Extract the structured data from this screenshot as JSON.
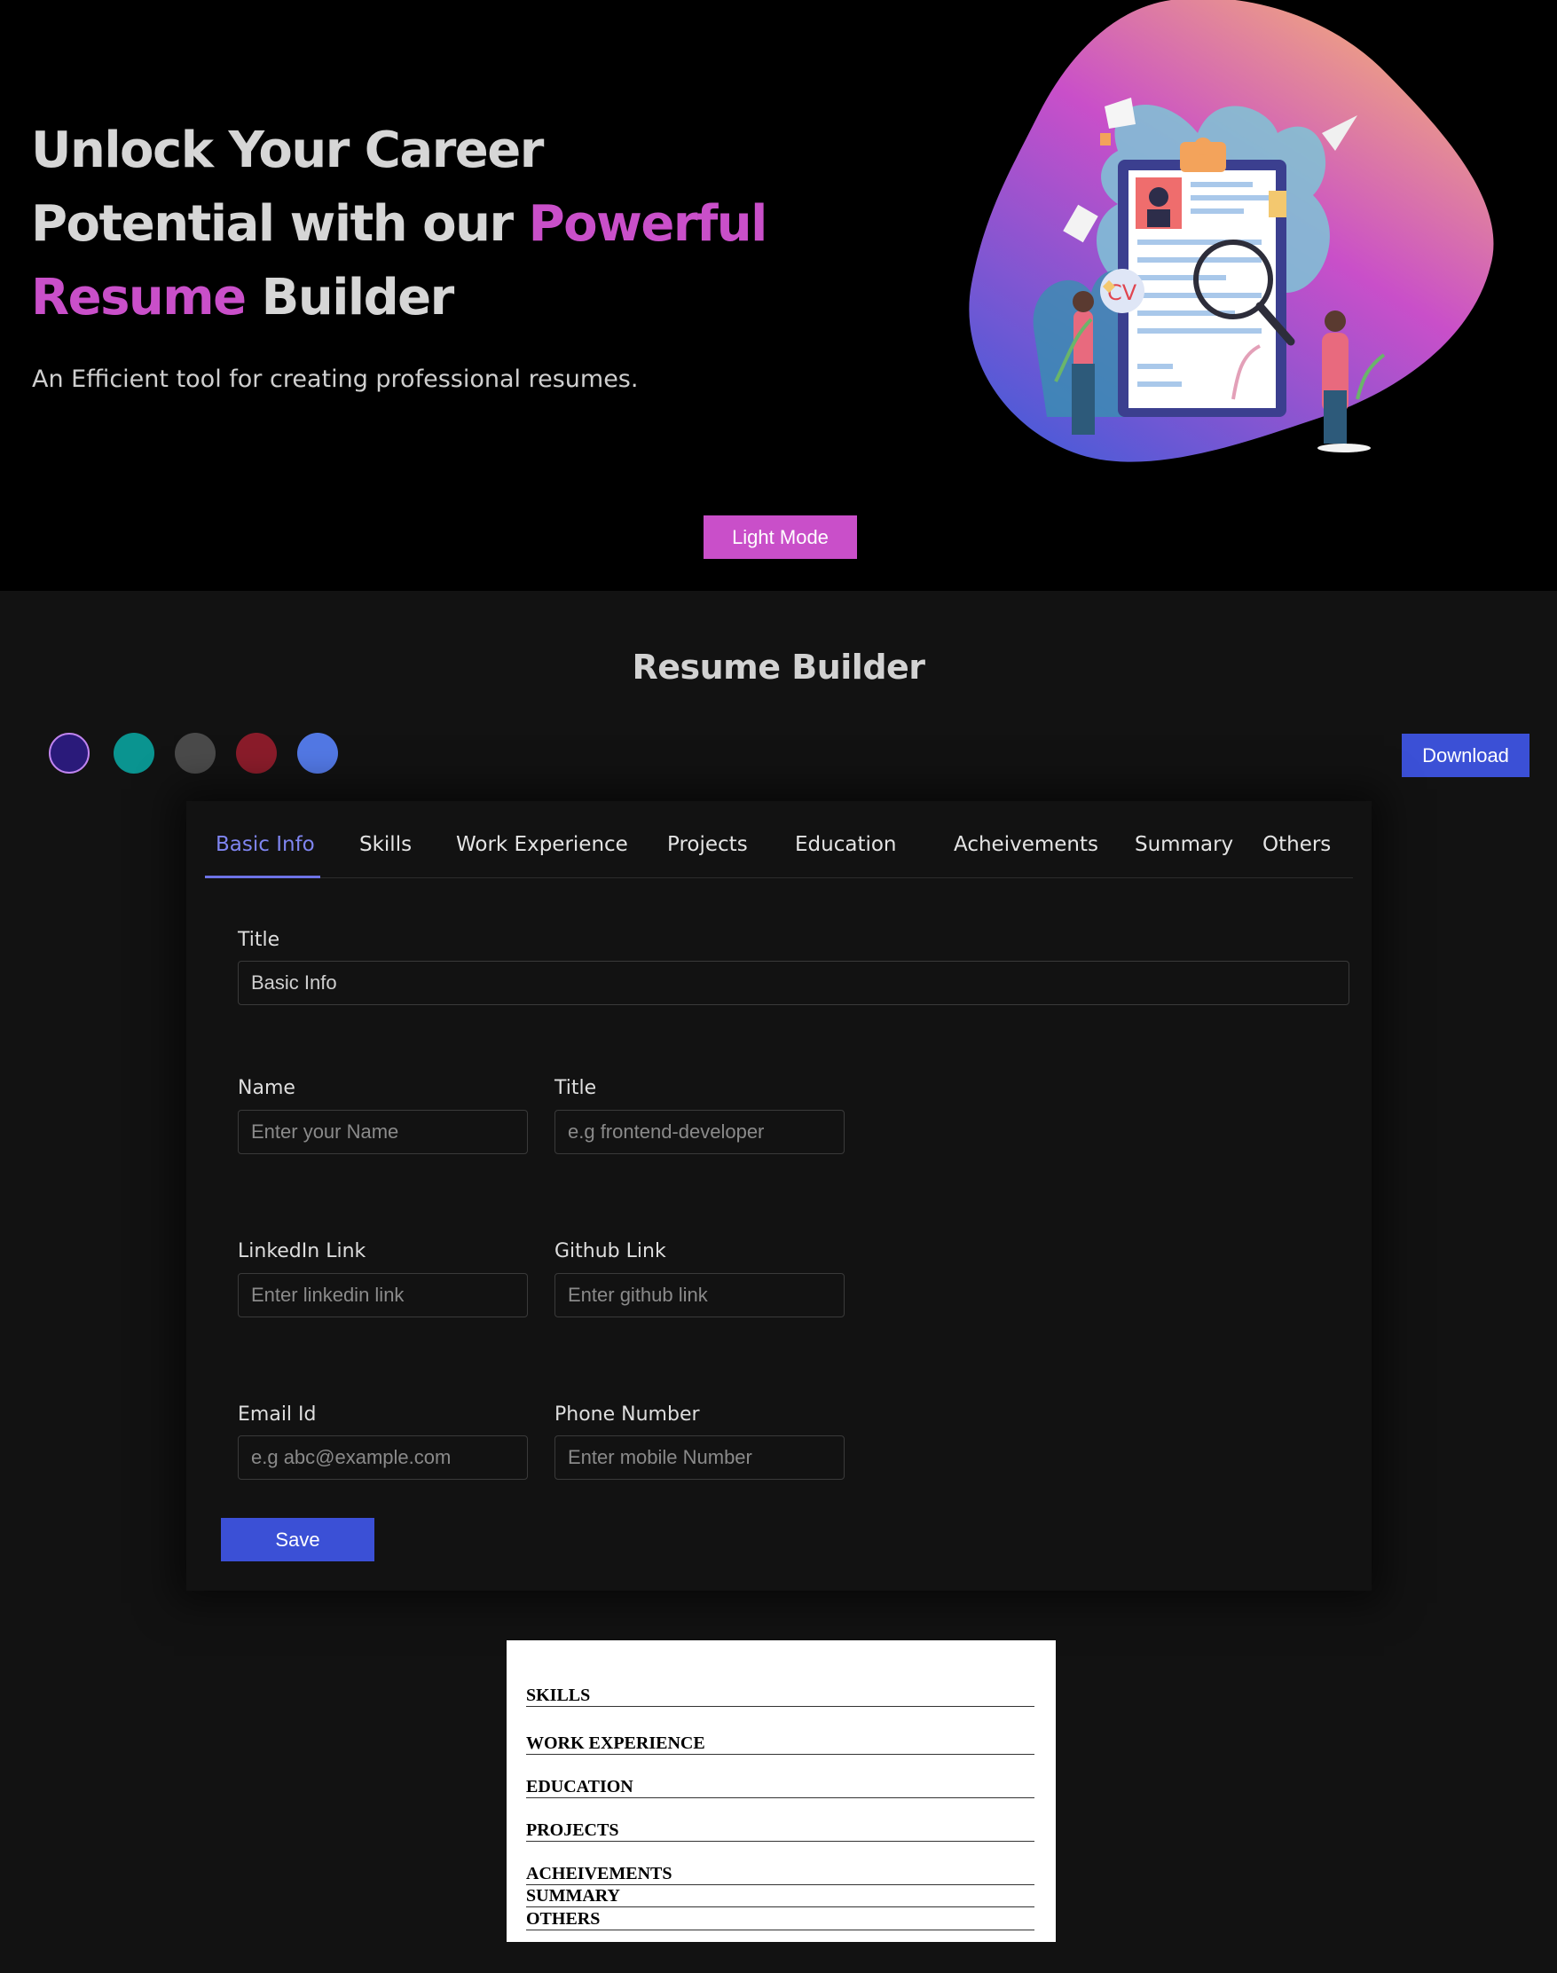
{
  "hero": {
    "heading_part1": "Unlock Your Career Potential with our ",
    "heading_accent": "Powerful Resume",
    "heading_part2": " Builder",
    "subtitle": "An Efficient tool for creating professional resumes.",
    "illustration_label": "CV",
    "light_mode_label": "Light Mode"
  },
  "builder": {
    "title": "Resume Builder",
    "download_label": "Download",
    "colors": [
      "#239ce2",
      "#48bb78",
      "#0bc5ea",
      "#a0aec0",
      "#ed8936"
    ],
    "swatches": [
      "#2a1a7a",
      "#0a9490",
      "#4a4a4a",
      "#8a1c2a",
      "#5278e4"
    ]
  },
  "tabs": [
    "Basic Info",
    "Skills",
    "Work Experience",
    "Projects",
    "Education",
    "Acheivements",
    "Summary",
    "Others"
  ],
  "form": {
    "section_title_label": "Title",
    "section_title_value": "Basic Info",
    "name_label": "Name",
    "name_placeholder": "Enter your Name",
    "title_label": "Title",
    "title_placeholder": "e.g frontend-developer",
    "linkedin_label": "LinkedIn Link",
    "linkedin_placeholder": "Enter linkedin link",
    "github_label": "Github Link",
    "github_placeholder": "Enter github link",
    "email_label": "Email Id",
    "email_placeholder": "e.g abc@example.com",
    "phone_label": "Phone Number",
    "phone_placeholder": "Enter mobile Number",
    "save_label": "Save"
  },
  "preview": {
    "sections": [
      "SKILLS",
      "WORK EXPERIENCE",
      "EDUCATION",
      "PROJECTS",
      "ACHEIVEMENTS",
      "SUMMARY",
      "OTHERS"
    ]
  }
}
